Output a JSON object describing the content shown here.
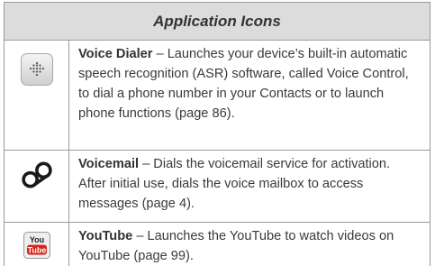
{
  "header": {
    "title": "Application Icons"
  },
  "rows": [
    {
      "icon": "voice-dialer-icon",
      "name": "Voice Dialer",
      "description": " – Launches your device’s built-in automatic speech recognition (ASR) software, called Voice Control, to dial a phone number in your Contacts or to launch phone functions (page 86)."
    },
    {
      "icon": "voicemail-icon",
      "name": "Voicemail",
      "description": " – Dials the voicemail service for activation. After initial use, dials the voice mailbox to access messages (page 4)."
    },
    {
      "icon": "youtube-icon",
      "icon_text_top": "You",
      "icon_text_bottom": "Tube",
      "icon_color": "#d3261c",
      "name": "YouTube",
      "description": " – Launches the YouTube to watch videos on YouTube (page 99)."
    }
  ]
}
